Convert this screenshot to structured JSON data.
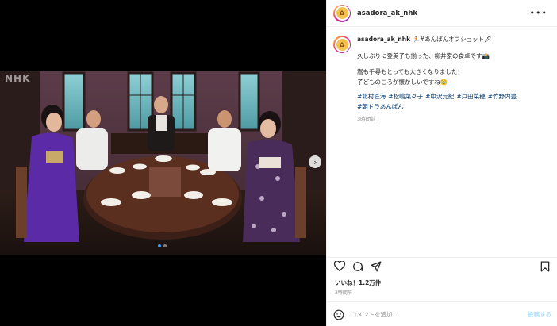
{
  "post": {
    "username": "asadora_ak_nhk",
    "more_icon": "more-horizontal-icon",
    "watermark": "NHK",
    "carousel": {
      "total": 2,
      "current": 1
    }
  },
  "caption": {
    "username": "asadora_ak_nhk",
    "first_line": "🏃#あんぱんオフショット🖊",
    "line2": "久しぶりに登美子も揃った、柳井家の食卓です📸",
    "line3": "嵩も千尋もとっても大きくなりました！",
    "line4": "子どものころが懐かしいですね🥹",
    "tags": [
      "#北村匠海",
      "#松嶋菜々子",
      "#中沢元紀",
      "#戸田菜穂",
      "#竹野内豊",
      "#朝ドラあんぱん"
    ],
    "time": "3時間前"
  },
  "actions": {
    "like_icon": "heart-icon",
    "comment_icon": "comment-icon",
    "share_icon": "send-icon",
    "save_icon": "bookmark-icon"
  },
  "stats": {
    "likes": "いいね！1.2万件",
    "posted": "3時間前"
  },
  "comment": {
    "placeholder": "コメントを追加...",
    "post_label": "投稿する",
    "emoji_icon": "emoji-icon"
  },
  "colors": {
    "link": "#00376b",
    "muted": "#8e8e8e",
    "post_disabled": "#b2dffc",
    "carousel_active": "#3897f0"
  }
}
